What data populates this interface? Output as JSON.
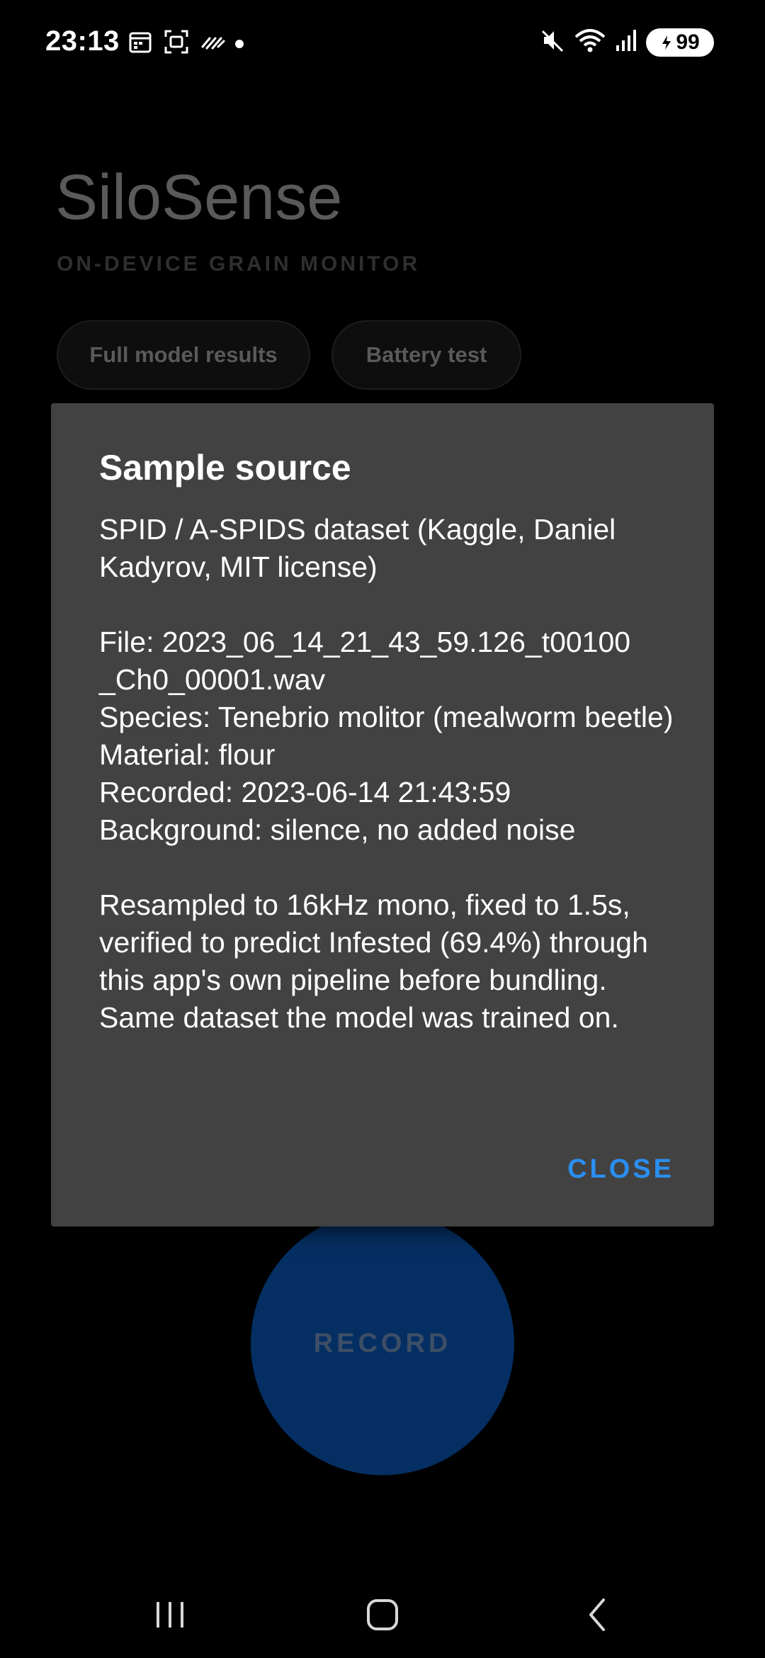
{
  "status_bar": {
    "time": "23:13",
    "battery": "99",
    "icons": [
      "calendar-icon",
      "screenshot-icon",
      "wave-icon",
      "dot-icon",
      "mute-icon",
      "wifi-icon",
      "signal-icon",
      "battery-icon"
    ]
  },
  "app": {
    "title": "SiloSense",
    "subtitle": "ON-DEVICE GRAIN MONITOR",
    "chips": {
      "full_results": "Full model results",
      "battery_test": "Battery test"
    },
    "record_label": "RECORD",
    "record_color": "#052f63"
  },
  "dialog": {
    "title": "Sample source",
    "source_line": "SPID / A-SPIDS dataset (Kaggle, Daniel Kadyrov, MIT license)",
    "file_line": "File: 2023_06_14_21_43_59.126_t00100 _Ch0_00001.wav",
    "species_line": "Species: Tenebrio molitor (mealworm beetle)",
    "material_line": "Material: flour",
    "recorded_line": "Recorded: 2023-06-14 21:43:59",
    "background_line": "Background: silence, no added noise",
    "notes": "Resampled to 16kHz mono, fixed to 1.5s, verified to predict Infested (69.4%) through this app's own pipeline before bundling. Same dataset the model was trained on.",
    "close_label": "CLOSE",
    "accent_color": "#2a8ff0"
  },
  "nav_bar": {
    "icons": [
      "recents-icon",
      "home-icon",
      "back-icon"
    ]
  }
}
